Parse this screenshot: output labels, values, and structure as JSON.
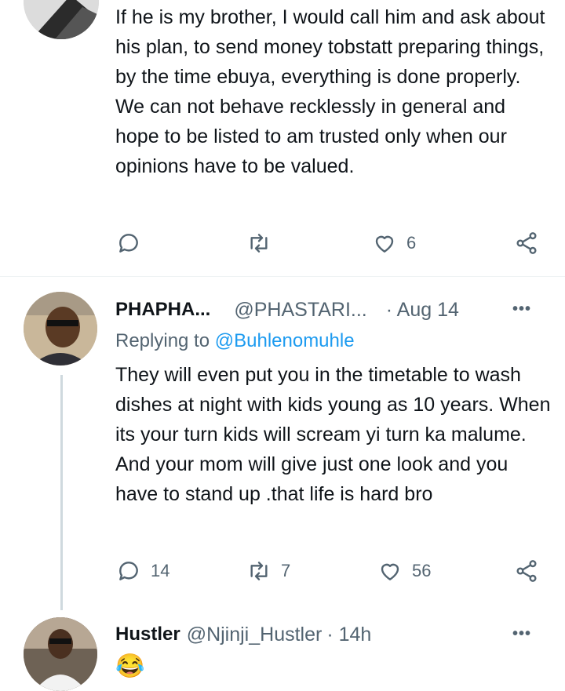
{
  "tweet1": {
    "text": "If he is my brother,  I would call him and ask about his plan, to send money tobstatt preparing things, by the time ebuya, everything is done properly. We can not behave recklessly in general and hope to be listed to am trusted only when our opinions have to be valued.",
    "likes": "6"
  },
  "tweet2": {
    "name": "PHAPHA...",
    "handle": "@PHASTARI...",
    "date": "· Aug 14",
    "replying_prefix": "Replying to",
    "replying_to": "@Buhlenomuhle",
    "text": "They will even put you in the timetable to wash dishes at night with kids young as 10 years. When its your turn kids will scream yi turn ka malume. And your mom will give just one look and you have to stand up .that life is hard bro",
    "replies": "14",
    "retweets": "7",
    "likes": "56"
  },
  "tweet3": {
    "name": "Hustler",
    "handle": "@Njinji_Hustler",
    "date": "· 14h",
    "emoji": "😂"
  },
  "icons": {
    "more": "•••"
  },
  "colors": {
    "text": "#0f1419",
    "muted": "#536471",
    "link": "#1d9bf0",
    "thread_line": "#cfd9de"
  }
}
